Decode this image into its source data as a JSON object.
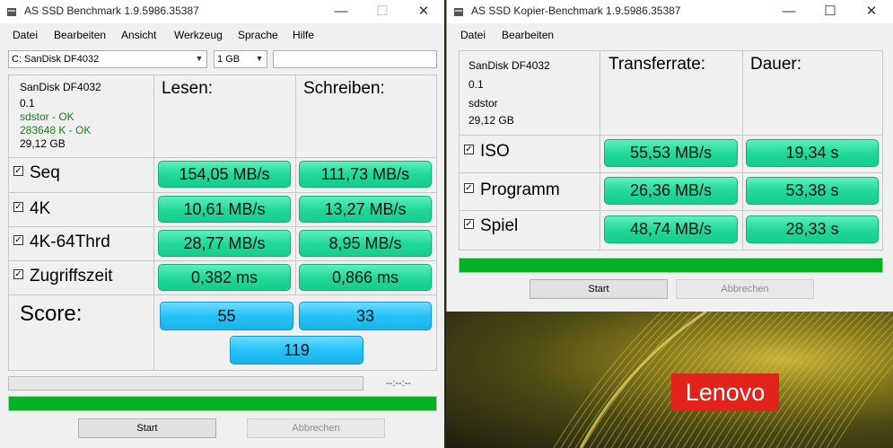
{
  "main": {
    "title": "AS SSD Benchmark 1.9.5986.35387",
    "menu": [
      "Datei",
      "Bearbeiten",
      "Ansicht",
      "Werkzeug",
      "Sprache",
      "Hilfe"
    ],
    "drive_select": "C: SanDisk DF4032",
    "size_select": "1 GB",
    "text_field": "",
    "info": {
      "model": "SanDisk DF4032",
      "firmware": "0.1",
      "driver": "sdstor - OK",
      "alignment": "283648 K - OK",
      "capacity": "29,12 GB"
    },
    "headers": {
      "read": "Lesen:",
      "write": "Schreiben:"
    },
    "rows": [
      {
        "label": "Seq",
        "read": "154,05 MB/s",
        "write": "111,73 MB/s"
      },
      {
        "label": "4K",
        "read": "10,61 MB/s",
        "write": "13,27 MB/s"
      },
      {
        "label": "4K-64Thrd",
        "read": "28,77 MB/s",
        "write": "8,95 MB/s"
      },
      {
        "label": "Zugriffszeit",
        "read": "0,382 ms",
        "write": "0,866 ms"
      }
    ],
    "score": {
      "label": "Score:",
      "read": "55",
      "write": "33",
      "total": "119"
    },
    "elapsed": "--:--:--",
    "upper_progress": 0,
    "main_progress": 1.0,
    "start": "Start",
    "cancel": "Abbrechen"
  },
  "copy": {
    "title": "AS SSD Kopier-Benchmark 1.9.5986.35387",
    "menu": [
      "Datei",
      "Bearbeiten"
    ],
    "info": {
      "model": "SanDisk DF4032",
      "firmware": "0.1",
      "driver": "sdstor",
      "capacity": "29,12 GB"
    },
    "headers": {
      "rate": "Transferrate:",
      "duration": "Dauer:"
    },
    "rows": [
      {
        "label": "ISO",
        "rate": "55,53 MB/s",
        "duration": "19,34 s"
      },
      {
        "label": "Programm",
        "rate": "26,36 MB/s",
        "duration": "53,38 s"
      },
      {
        "label": "Spiel",
        "rate": "48,74 MB/s",
        "duration": "28,33 s"
      }
    ],
    "progress": 1.0,
    "start": "Start",
    "cancel": "Abbrechen"
  },
  "wallpaper": {
    "logo": "Lenovo"
  },
  "colors": {
    "green_value": "#22d99a",
    "blue_value": "#25c2f7",
    "progress_fill": "#06b025",
    "ok_text": "#1a7d1a",
    "lenovo_red": "#e2231a"
  }
}
